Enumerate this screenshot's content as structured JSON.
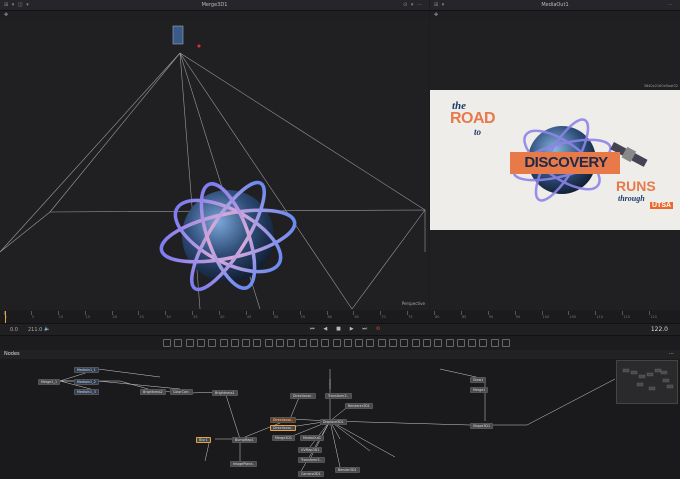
{
  "left_viewer": {
    "title": "Merge3D1",
    "header_left": "⊞ ▾  ◫ ▾",
    "header_right": "⊙ ▾ ⋯",
    "toolbar_left": "✥",
    "corner_label": "Perspective"
  },
  "right_viewer": {
    "title": "MediaOut1",
    "header_left": "⊞ ▾",
    "header_right": "⋯",
    "toolbar_left": "✥",
    "resolution": "3840x2160xfloat32"
  },
  "title_card": {
    "the": "the",
    "road": "ROAD",
    "to": "to",
    "discovery": "DISCOVERY",
    "runs": "RUNS",
    "through": "through",
    "utsa": "UTSA"
  },
  "timeline": {
    "ruler_labels": [
      "0",
      "5",
      "10",
      "15",
      "20",
      "25",
      "30",
      "35",
      "40",
      "45",
      "50",
      "55",
      "60",
      "65",
      "70",
      "75",
      "80",
      "85",
      "90",
      "95",
      "100",
      "105",
      "110",
      "115",
      "120"
    ],
    "start_time": "0.0",
    "end_time": "211.0",
    "current_time": "122.0",
    "transport": [
      "⏮",
      "◀",
      "■",
      "▶",
      "⏭",
      "⟲"
    ]
  },
  "nodes_panel": {
    "title": "Nodes",
    "menu": "⋯",
    "nodes": [
      {
        "label": "MediaIn1_1",
        "style": "blue"
      },
      {
        "label": "Merge1_1",
        "style": "gray"
      },
      {
        "label": "MediaIn1_2",
        "style": "blue"
      },
      {
        "label": "MediaIn1_3",
        "style": "blue"
      },
      {
        "label": "Brightness2",
        "style": "gray"
      },
      {
        "label": "ColorCorr..",
        "style": "gray"
      },
      {
        "label": "Brightness1",
        "style": "gray"
      },
      {
        "label": "Blur1",
        "style": "gray"
      },
      {
        "label": "BumpMap1",
        "style": "gray"
      },
      {
        "label": "ImagePlane..",
        "style": "gray"
      },
      {
        "label": "Directional..",
        "style": "gray"
      },
      {
        "label": "Directional..",
        "style": "orange"
      },
      {
        "label": "Directional..",
        "style": "gray"
      },
      {
        "label": "Merge3D1",
        "style": "gray"
      },
      {
        "label": "Displace3D1",
        "style": "gray"
      },
      {
        "label": "Transform3..",
        "style": "gray"
      },
      {
        "label": "Renderer3D1",
        "style": "gray"
      },
      {
        "label": "Shape3D1",
        "style": "gray"
      },
      {
        "label": "Camera3D1",
        "style": "gray"
      },
      {
        "label": "Bender3D1",
        "style": "gray"
      },
      {
        "label": "UVMap3D1",
        "style": "gray"
      },
      {
        "label": "Transform3..",
        "style": "gray"
      },
      {
        "label": "MediaOut1",
        "style": "gray"
      },
      {
        "label": "Glow1",
        "style": "gray"
      },
      {
        "label": "Merge1",
        "style": "gray"
      }
    ]
  },
  "colors": {
    "accent": "#e8a33a",
    "utsa_orange": "#e86a2c",
    "discovery_orange": "#e87a4a",
    "background": "#1c1c1e"
  }
}
